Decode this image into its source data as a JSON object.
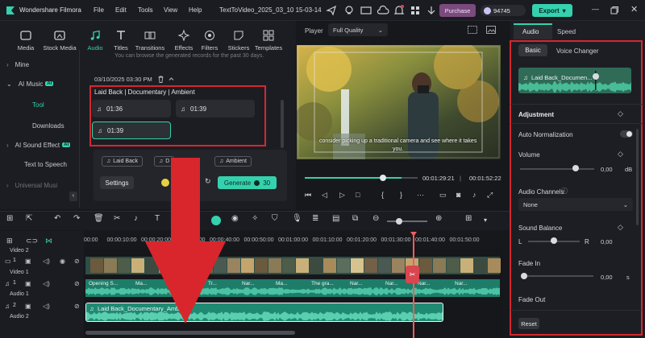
{
  "app": {
    "title": "Wondershare Filmora",
    "project_name": "TextToVideo_2025_03_10 15-03-14"
  },
  "menu": [
    "File",
    "Edit",
    "Tools",
    "View",
    "Help"
  ],
  "titlebar": {
    "purchase": "Purchase",
    "credits": "94745",
    "export": "Export"
  },
  "tool_tabs": [
    {
      "label": "Media",
      "icon": "media-icon"
    },
    {
      "label": "Stock Media",
      "icon": "stock-media-icon"
    },
    {
      "label": "Audio",
      "icon": "audio-icon",
      "active": true
    },
    {
      "label": "Titles",
      "icon": "titles-icon"
    },
    {
      "label": "Transitions",
      "icon": "transitions-icon"
    },
    {
      "label": "Effects",
      "icon": "effects-icon"
    },
    {
      "label": "Filters",
      "icon": "filters-icon"
    },
    {
      "label": "Stickers",
      "icon": "stickers-icon"
    },
    {
      "label": "Templates",
      "icon": "templates-icon"
    }
  ],
  "side_nav": {
    "mine": "Mine",
    "ai_music": "AI Music",
    "ai_badge": "AI",
    "tool": "Tool",
    "downloads": "Downloads",
    "ai_sound_effect": "AI Sound Effect",
    "text_to_speech": "Text to Speech",
    "universal_music": "Universal Musi"
  },
  "content": {
    "hint": "You can browse the generated records for the past 30 days.",
    "record_time": "03/10/2025 03:30 PM",
    "record_title": "Laid Back | Documentary | Ambient",
    "clips": [
      "01:36",
      "01:39",
      "01:39"
    ],
    "tags": [
      "Laid Back",
      "D",
      "Ambient"
    ],
    "settings": "Settings",
    "generate": "Generate",
    "generate_count": "30"
  },
  "player": {
    "label": "Player",
    "quality": "Full Quality",
    "subtitle_line1": "consider picking up a traditional camera and see where it takes",
    "subtitle_line2": "you.",
    "current_time": "00:01:29:21",
    "total_time": "00:01:52:22"
  },
  "right_panel": {
    "tabs": [
      "Audio",
      "Speed"
    ],
    "subtabs": [
      "Basic",
      "Voice Changer"
    ],
    "clip_name": "Laid Back_Documen...",
    "adjustment": "Adjustment",
    "auto_normalization": "Auto Normalization",
    "volume": "Volume",
    "volume_value": "0,00",
    "volume_unit": "dB",
    "volume_level": 0.75,
    "audio_channels": "Audio Channels",
    "channels_value": "None",
    "sound_balance": "Sound Balance",
    "balance_left": "L",
    "balance_right": "R",
    "balance_value": "0,00",
    "balance_level": 0.5,
    "fade_in": "Fade In",
    "fade_in_value": "0,00",
    "fade_in_unit": "s",
    "fade_out": "Fade Out",
    "reset": "Reset"
  },
  "timeline": {
    "ruler": [
      "00:00",
      "00:00:10:00",
      "00:00:20:00",
      "00:00:30:00",
      "00:00:40:00",
      "00:00:50:00",
      "00:01:00:00",
      "00:01:10:00",
      "00:01:20:00",
      "00:01:30:00",
      "00:01:40:00",
      "00:01:50:00"
    ],
    "tracks": [
      {
        "name": "Video 2",
        "index": ""
      },
      {
        "name": "Video 1",
        "index": "1"
      },
      {
        "name": "Audio 1",
        "index": "1"
      },
      {
        "name": "Audio 2",
        "index": "2"
      }
    ],
    "audio1_labels": [
      "Opening S...",
      "Ma...",
      "Na...",
      "Tr...",
      "Nar...",
      "Ma...",
      "The gra...",
      "Nar...",
      "Nar...",
      "Nar...",
      "Nar..."
    ],
    "audio2_clip": "Laid Back_Documentary_Ambient"
  },
  "colors": {
    "accent": "#35d1ae",
    "highlight": "#d3282e",
    "purchase": "#7b4a7e",
    "playhead": "#f15d5d"
  }
}
